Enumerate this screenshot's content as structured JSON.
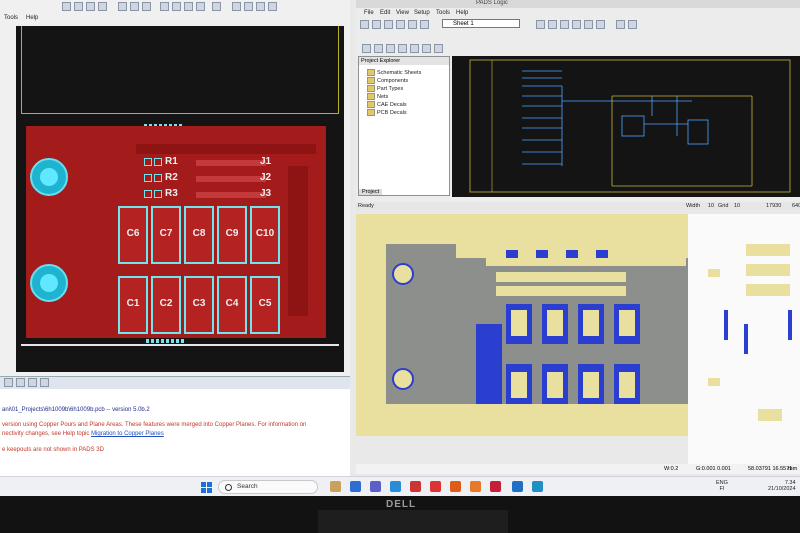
{
  "pads_layout": {
    "menu": [
      "Tools",
      "Help"
    ],
    "components": {
      "resistors": [
        "R1",
        "R2",
        "R3"
      ],
      "connectors": [
        "J1",
        "J2",
        "J3"
      ],
      "caps_top": [
        "C6",
        "C7",
        "C8",
        "C9",
        "C10"
      ],
      "caps_bottom": [
        "C1",
        "C2",
        "C3",
        "C4",
        "C5"
      ]
    },
    "output": {
      "path_text": "ani\\01_Projects\\6h1009b\\6h1009b.pcb -- version 5.0b.2",
      "msg1": "version using Copper Pours and Plane Areas. These features were merged into Copper Planes. For information on",
      "msg2_prefix": "nectivity changes, see Help topic",
      "msg2_link": "Migration to Copper Planes",
      "msg3": "e keepouts are not shown in PADS 3D"
    }
  },
  "pads_logic": {
    "menu": [
      "File",
      "Edit",
      "View",
      "Setup",
      "Tools",
      "Help"
    ],
    "title": "PADS Logic",
    "sheet": "Sheet 1",
    "project_explorer": {
      "title": "Project Explorer",
      "items": [
        "Schematic Sheets",
        "Components",
        "Part Types",
        "Nets",
        "CAE Decals",
        "PCB Decals"
      ],
      "tab": "Project"
    },
    "status": {
      "ready": "Ready",
      "width_label": "Width",
      "width_value": "10",
      "grid_label": "Grid",
      "grid_value": "10",
      "coord": "17930",
      "coord2": "640"
    }
  },
  "pads_3d": {
    "status": {
      "w": "W:0.2",
      "g": "G:0.001 0.001",
      "coords": "58.03791 16.5571",
      "mm": "mm"
    }
  },
  "taskbar": {
    "search_placeholder": "Search",
    "lang_1": "ENG",
    "lang_2": "FI",
    "time": "7.34",
    "date": "21/10/2024"
  },
  "colors": {
    "copper": "#a41b1b",
    "pad_outline": "#6fe6ee",
    "board_3d": "#8c8f8c",
    "pad_3d": "#e8dc9a",
    "smt_3d": "#2a3fd0"
  }
}
